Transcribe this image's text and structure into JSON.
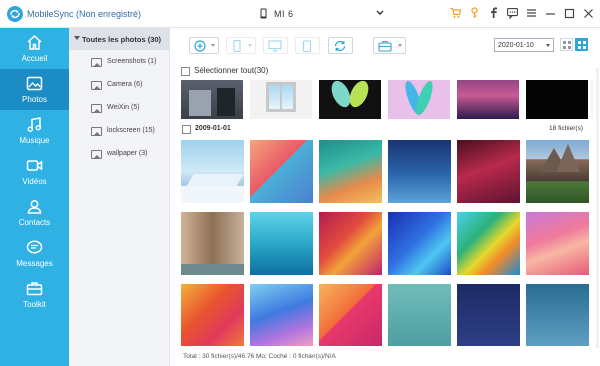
{
  "app": {
    "title": "MobileSync (Non enregistré)"
  },
  "device": {
    "name": "MI 6"
  },
  "titlebar_icons": [
    "cart-icon",
    "key-icon",
    "facebook-icon",
    "chat-icon",
    "menu-icon",
    "minimize-icon",
    "maximize-icon",
    "close-icon"
  ],
  "sidebar": {
    "items": [
      {
        "label": "Accueil",
        "icon": "home-icon",
        "active": false
      },
      {
        "label": "Photos",
        "icon": "photo-icon",
        "active": true
      },
      {
        "label": "Musique",
        "icon": "music-icon",
        "active": false
      },
      {
        "label": "Vidéos",
        "icon": "video-icon",
        "active": false
      },
      {
        "label": "Contacts",
        "icon": "contacts-icon",
        "active": false
      },
      {
        "label": "Messages",
        "icon": "messages-icon",
        "active": false
      },
      {
        "label": "Toolkit",
        "icon": "toolkit-icon",
        "active": false
      }
    ]
  },
  "categories": {
    "header": "Toutes les photos (30)",
    "items": [
      {
        "label": "Screenshots (1)"
      },
      {
        "label": "Camera (6)"
      },
      {
        "label": "WeiXin (5)"
      },
      {
        "label": "lockscreen (15)"
      },
      {
        "label": "wallpaper (3)"
      }
    ]
  },
  "toolbar": {
    "date_value": "2020-01-10",
    "buttons": [
      "add-icon",
      "export-to-device-icon",
      "export-to-pc-icon",
      "delete-icon",
      "refresh-icon",
      "toolbox-icon"
    ]
  },
  "select_all": {
    "label": "Sélectionner tout(30)"
  },
  "group": {
    "date": "2009-01-01",
    "count": "18 fichier(s)"
  },
  "status": {
    "text": "Total : 30 fichier(s)/46.76 Mo; Coché : 0 fichier(s)/N/A"
  },
  "colors": {
    "sidebar": "#2fb1e4",
    "sidebar_active": "#1b8cc4",
    "accent": "#2fa6db",
    "toolbar_icon_orange": "#f0a020"
  }
}
